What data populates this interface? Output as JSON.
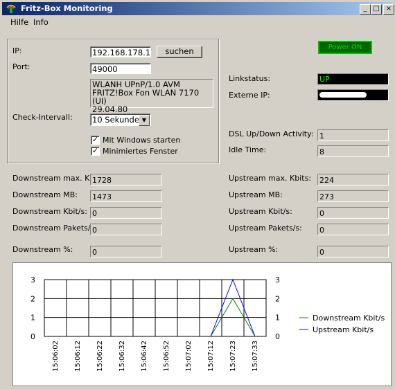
{
  "window": {
    "title": "Fritz-Box Monitoring",
    "minimize": "_",
    "maximize": "□",
    "close": "×"
  },
  "menu": {
    "help": "Hilfe",
    "info": "Info"
  },
  "connection": {
    "ip_label": "IP:",
    "ip_value": "192.168.178.1",
    "search_label": "suchen",
    "port_label": "Port:",
    "port_value": "49000",
    "device_info": [
      "WLANH UPnP/1.0 AVM",
      "FRITZ!Box Fon WLAN 7170 (UI)",
      "29.04.80"
    ],
    "interval_label": "Check-Intervall:",
    "interval_value": "10 Sekunden",
    "autostart_label": "Mit Windows starten",
    "autostart_checked": true,
    "minimized_label": "Minimiertes Fenster",
    "minimized_checked": true
  },
  "status": {
    "power_label": "Power ON",
    "link_label": "Linkstatus:",
    "link_value": "UP",
    "extip_label": "Externe IP:",
    "dsl_label": "DSL Up/Down Activity:",
    "dsl_value": "1",
    "idle_label": "Idle Time:",
    "idle_value": "8"
  },
  "downstream": {
    "max_label": "Downstream max. Kbits:",
    "max_value": "1728",
    "mb_label": "Downstream MB:",
    "mb_value": "1473",
    "kbit_label": "Downstream Kbit/s:",
    "kbit_value": "0",
    "pakets_label": "Downstream Pakets/s:",
    "pakets_value": "0",
    "pct_label": "Downstream %:",
    "pct_value": "0"
  },
  "upstream": {
    "max_label": "Upstream max. Kbits:",
    "max_value": "224",
    "mb_label": "Upstream MB:",
    "mb_value": "273",
    "kbit_label": "Upstream Kbit/s:",
    "kbit_value": "0",
    "pakets_label": "Upstream Pakets/s:",
    "pakets_value": "0",
    "pct_label": "Upstream %:",
    "pct_value": "0"
  },
  "colors": {
    "downstream": "#008000",
    "upstream": "#0000ff"
  },
  "chart_data": {
    "type": "line",
    "x": [
      "15:06:02",
      "15:06:12",
      "15:06:22",
      "15:06:32",
      "15:06:42",
      "15:06:52",
      "15:07:02",
      "15:07:12",
      "15:07:23",
      "15:07:33"
    ],
    "ylim": [
      0,
      3
    ],
    "yticks": [
      "0",
      "1",
      "2",
      "3"
    ],
    "series": [
      {
        "name": "Downstream Kbit/s",
        "values": [
          null,
          null,
          null,
          null,
          null,
          null,
          null,
          0,
          2,
          0
        ]
      },
      {
        "name": "Upstream Kbit/s",
        "values": [
          null,
          null,
          null,
          null,
          null,
          null,
          null,
          0,
          3,
          0
        ]
      }
    ],
    "legend": "right"
  }
}
